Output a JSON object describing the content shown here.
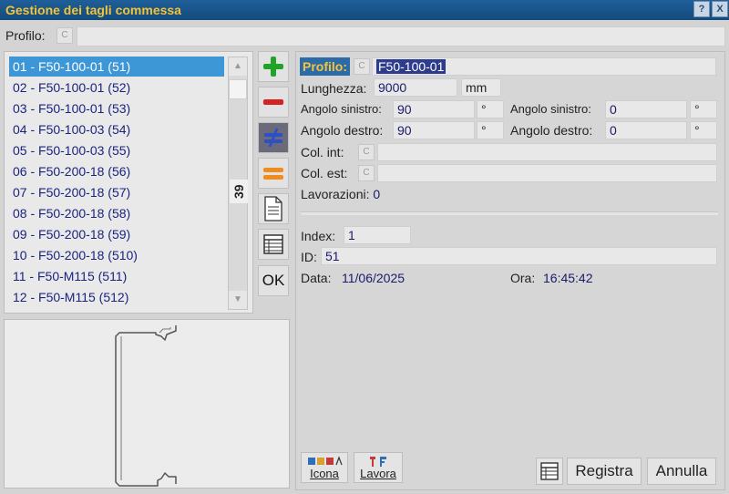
{
  "window": {
    "title": "Gestione dei tagli commessa",
    "help_label": "?",
    "close_label": "X"
  },
  "search": {
    "label": "Profilo:",
    "c_label": "C",
    "value": ""
  },
  "list": {
    "items": [
      "01 - F50-100-01 (51)",
      "02 - F50-100-01 (52)",
      "03 - F50-100-01 (53)",
      "04 - F50-100-03 (54)",
      "05 - F50-100-03 (55)",
      "06 - F50-200-18 (56)",
      "07 - F50-200-18 (57)",
      "08 - F50-200-18 (58)",
      "09 - F50-200-18 (59)",
      "10 - F50-200-18 (510)",
      "11 - F50-M115 (511)",
      "12 - F50-M115 (512)"
    ],
    "selected_index": 0,
    "count": "39"
  },
  "tools": {
    "ok_label": "OK"
  },
  "detail": {
    "profilo_label": "Profilo:",
    "profilo_value": "F50-100-01",
    "c_label": "C",
    "lunghezza_label": "Lunghezza:",
    "lunghezza_value": "9000",
    "lunghezza_unit": "mm",
    "angolo_sinistro_label": "Angolo sinistro:",
    "angolo_sinistro_value": "90",
    "angolo_sinistro2_label": "Angolo sinistro:",
    "angolo_sinistro2_value": "0",
    "angolo_destro_label": "Angolo destro:",
    "angolo_destro_value": "90",
    "angolo_destro2_label": "Angolo destro:",
    "angolo_destro2_value": "0",
    "degree": "°",
    "col_int_label": "Col. int:",
    "col_est_label": "Col. est:",
    "lavorazioni_label": "Lavorazioni:",
    "lavorazioni_value": "0",
    "index_label": "Index:",
    "index_value": "1",
    "id_label": "ID:",
    "id_value": "51",
    "data_label": "Data:",
    "data_value": "11/06/2025",
    "ora_label": "Ora:",
    "ora_value": "16:45:42"
  },
  "footer": {
    "icona_label": "Icona",
    "lavora_label": "Lavora",
    "registra_label": "Registra",
    "annulla_label": "Annulla"
  }
}
